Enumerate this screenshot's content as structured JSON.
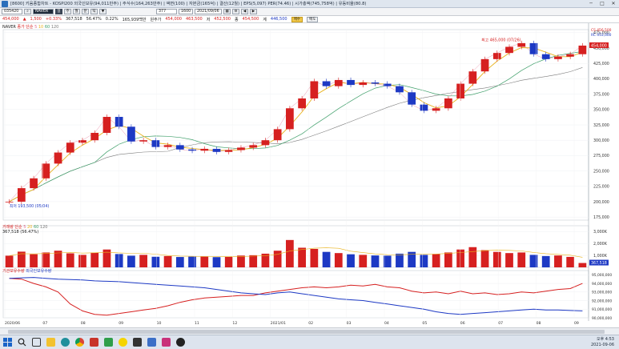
{
  "window": {
    "title": "[8600] 키움종합차트 - KOSPI200 외국인보유(94,011만주) | 주식수(164,263만주) | 액면(100) | 자본금(165억) | 결산(12월) | EPS(5,097) PER(74.46) | 시가총액(745,758억) | 유동비율(80.8)",
    "min": "─",
    "max": "□",
    "close": "✕"
  },
  "toolbar": {
    "code": "035420",
    "name": "NAVER",
    "period": "377",
    "period2": "1600",
    "date": "2021/09/06",
    "buttons": [
      "일",
      "주",
      "월",
      "분",
      "틱",
      "▼"
    ]
  },
  "price": {
    "current": "454,000",
    "arrow": "▲",
    "change": "1,500",
    "change_rate": "+0.33%",
    "volume": "367,518",
    "vol_rate": "56.47%",
    "turnover": "0.22%",
    "amount": "165,939백만",
    "open_label": "원주가",
    "open": "454,000",
    "high": "463,500",
    "low_label": "저",
    "low": "452,500",
    "close_label": "종",
    "close": "454,500",
    "ask_label": "계",
    "ask": "446,500",
    "btn_sell": "매수",
    "btn_buy": "매도"
  },
  "legends": {
    "price": "NAVER",
    "ma": [
      "종가",
      "단순",
      "5",
      "10",
      "60",
      "120"
    ],
    "volume": "거래량",
    "volume_ma": [
      "단순",
      "5",
      "20",
      "60",
      "120"
    ],
    "volume_value": "367,518",
    "volume_rate": "(56.47%)",
    "foreign": "기관보유수량",
    "foreign2": "외국인보유수량"
  },
  "annotations": {
    "high": "최고 465,000 (07/26)",
    "low": "최저 193,500 (05/04)",
    "price_tag": "454,000",
    "price_tag_sub": "",
    "mini1": "CS 456,500",
    "mini2": "RC 453,000"
  },
  "axis": {
    "price_ticks": [
      "475,000",
      "450,000",
      "425,000",
      "400,000",
      "375,000",
      "350,000",
      "325,000",
      "300,000",
      "275,000",
      "250,000",
      "225,000",
      "200,000",
      "175,000"
    ],
    "volume_ticks": [
      "3,000K",
      "2,000K",
      "1,000K"
    ],
    "volume_tag": "367,518",
    "foreign_ticks": [
      "95,000,000",
      "94,000,000",
      "93,000,000",
      "92,000,000",
      "91,000,000",
      "90,000,000"
    ],
    "x_labels": [
      "2020/06",
      "07",
      "08",
      "09",
      "10",
      "11",
      "12",
      "2021/01",
      "02",
      "03",
      "04",
      "05",
      "06",
      "07",
      "08",
      "09"
    ]
  },
  "chart_data": [
    {
      "type": "line",
      "title": "",
      "xlabel": "",
      "ylabel": "",
      "ylim": [
        170000,
        480000
      ],
      "series": [
        {
          "name": "NAVER",
          "values": [
            200000,
            222000,
            238000,
            262000,
            280000,
            296000,
            300000,
            312000,
            338000,
            322000,
            298000,
            300000,
            289000,
            292000,
            285000,
            283000,
            286000,
            281000,
            284000,
            288000,
            292000,
            300000,
            318000,
            352000,
            368000,
            396000,
            388000,
            398000,
            390000,
            394000,
            392000,
            388000,
            378000,
            358000,
            348000,
            352000,
            368000,
            392000,
            412000,
            432000,
            442000,
            452000,
            458000,
            440000,
            432000,
            436000,
            440000,
            454000
          ]
        }
      ]
    },
    {
      "type": "bar",
      "title": "",
      "xlabel": "",
      "ylabel": "",
      "ylim": [
        0,
        3500
      ],
      "series": [
        {
          "name": "거래량",
          "values": [
            980,
            1320,
            1100,
            1250,
            1400,
            1180,
            1050,
            1230,
            1500,
            1120,
            980,
            1050,
            890,
            950,
            870,
            900,
            920,
            860,
            910,
            990,
            1020,
            1150,
            1400,
            2300,
            1650,
            1550,
            1300,
            1200,
            1100,
            1050,
            1000,
            980,
            1150,
            1300,
            1050,
            1120,
            1250,
            1500,
            1700,
            1450,
            1300,
            1200,
            1250,
            1050,
            950,
            1000,
            880,
            367
          ]
        }
      ]
    },
    {
      "type": "line",
      "title": "",
      "xlabel": "",
      "ylabel": "",
      "ylim": [
        90000000,
        95500000
      ],
      "series": [
        {
          "name": "기관보유수량",
          "values": [
            94600000,
            94500000,
            94000000,
            93600000,
            93000000,
            91600000,
            90800000,
            90400000,
            90300000,
            90500000,
            90700000,
            90900000,
            91100000,
            91400000,
            91800000,
            92100000,
            92300000,
            92400000,
            92500000,
            92600000,
            92600000,
            92900000,
            93100000,
            93300000,
            93500000,
            93600000,
            93500000,
            93600000,
            93800000,
            93700000,
            93900000,
            93600000,
            93500000,
            93100000,
            92900000,
            93000000,
            92800000,
            93100000,
            92800000,
            92900000,
            92700000,
            92800000,
            93000000,
            92900000,
            93100000,
            93300000,
            93400000,
            94000000
          ]
        },
        {
          "name": "외국인보유수량",
          "values": [
            94600000,
            94650000,
            94700000,
            94600000,
            94500000,
            94450000,
            94400000,
            94300000,
            94250000,
            94200000,
            94100000,
            94000000,
            93900000,
            93800000,
            93700000,
            93600000,
            93500000,
            93300000,
            93100000,
            92900000,
            92800000,
            92700000,
            92900000,
            93000000,
            92800000,
            92600000,
            92400000,
            92200000,
            92100000,
            92000000,
            91800000,
            91600000,
            91400000,
            91200000,
            91000000,
            90700000,
            90500000,
            90400000,
            90500000,
            90600000,
            90700000,
            90800000,
            90900000,
            91000000,
            90900000,
            90900000,
            90850000,
            90800000
          ]
        }
      ]
    }
  ],
  "taskbar": {
    "time": "오후 4:53",
    "date": "2021-09-06"
  },
  "colors": {
    "candle_up": "#d62020",
    "candle_down": "#1d39c4",
    "ma5": "#e06b8f",
    "ma20": "#e8b21b",
    "ma60": "#3f9f6a",
    "ma120": "#7a7a7a",
    "foreign_inst": "#d62020",
    "foreign_ext": "#1d39c4"
  }
}
